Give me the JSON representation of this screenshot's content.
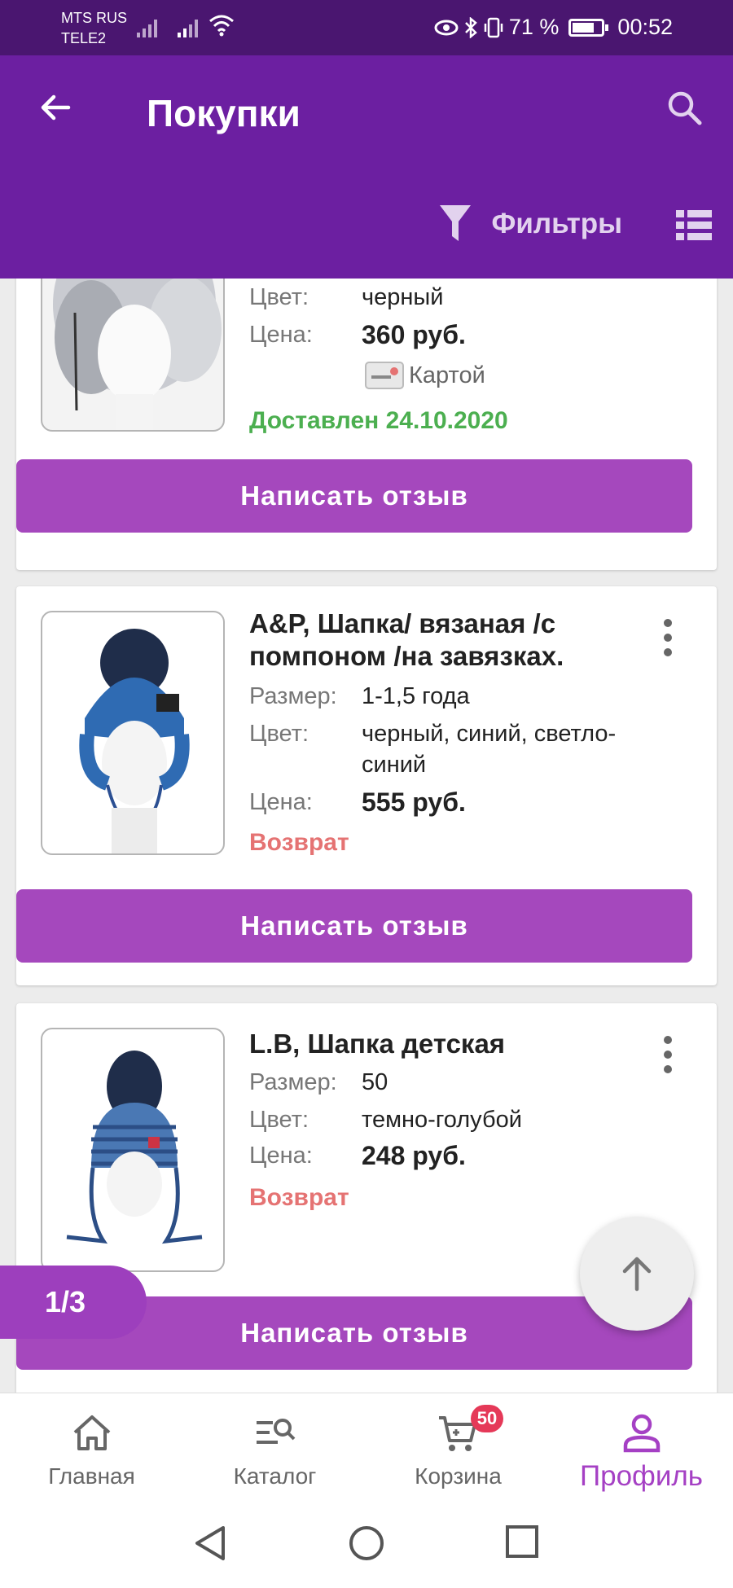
{
  "status_bar": {
    "carrier1": "MTS RUS",
    "carrier2": "TELE2",
    "battery": "71 %",
    "time": "00:52"
  },
  "app_bar": {
    "title": "Покупки",
    "filters_label": "Фильтры",
    "icons": [
      "back-arrow-icon",
      "search-icon",
      "filter-icon",
      "list-view-icon"
    ]
  },
  "orders": [
    {
      "color_label": "Цвет:",
      "color": "черный",
      "price_label": "Цена:",
      "price": "360 руб.",
      "payment": "Картой",
      "status": "Доставлен 24.10.2020",
      "review_button": "Написать отзыв"
    },
    {
      "name": "A&P, Шапка/ вязаная /с помпоном /на завязках.",
      "size_label": "Размер:",
      "size": "1-1,5 года",
      "color_label": "Цвет:",
      "color": "черный, синий, светло-синий",
      "price_label": "Цена:",
      "price": "555 руб.",
      "status": "Возврат",
      "review_button": "Написать отзыв"
    },
    {
      "name": "L.B, Шапка детская",
      "size_label": "Размер:",
      "size": "50",
      "color_label": "Цвет:",
      "color": "темно-голубой",
      "price_label": "Цена:",
      "price": "248 руб.",
      "status": "Возврат",
      "review_button": "Написать отзыв"
    }
  ],
  "pager": "1/3",
  "bottom_nav": [
    {
      "label": "Главная",
      "icon": "home-icon"
    },
    {
      "label": "Каталог",
      "icon": "catalog-search-icon"
    },
    {
      "label": "Корзина",
      "icon": "cart-icon",
      "badge": "50"
    },
    {
      "label": "Профиль",
      "icon": "profile-icon",
      "active": true
    }
  ],
  "colors": {
    "app_bar": "#6c1fa1",
    "status_bar": "#4a1670",
    "button": "#a548bd",
    "delivered": "#4caf50",
    "refund": "#e57373",
    "active_nav": "#a540c4",
    "badge": "#e53958"
  }
}
